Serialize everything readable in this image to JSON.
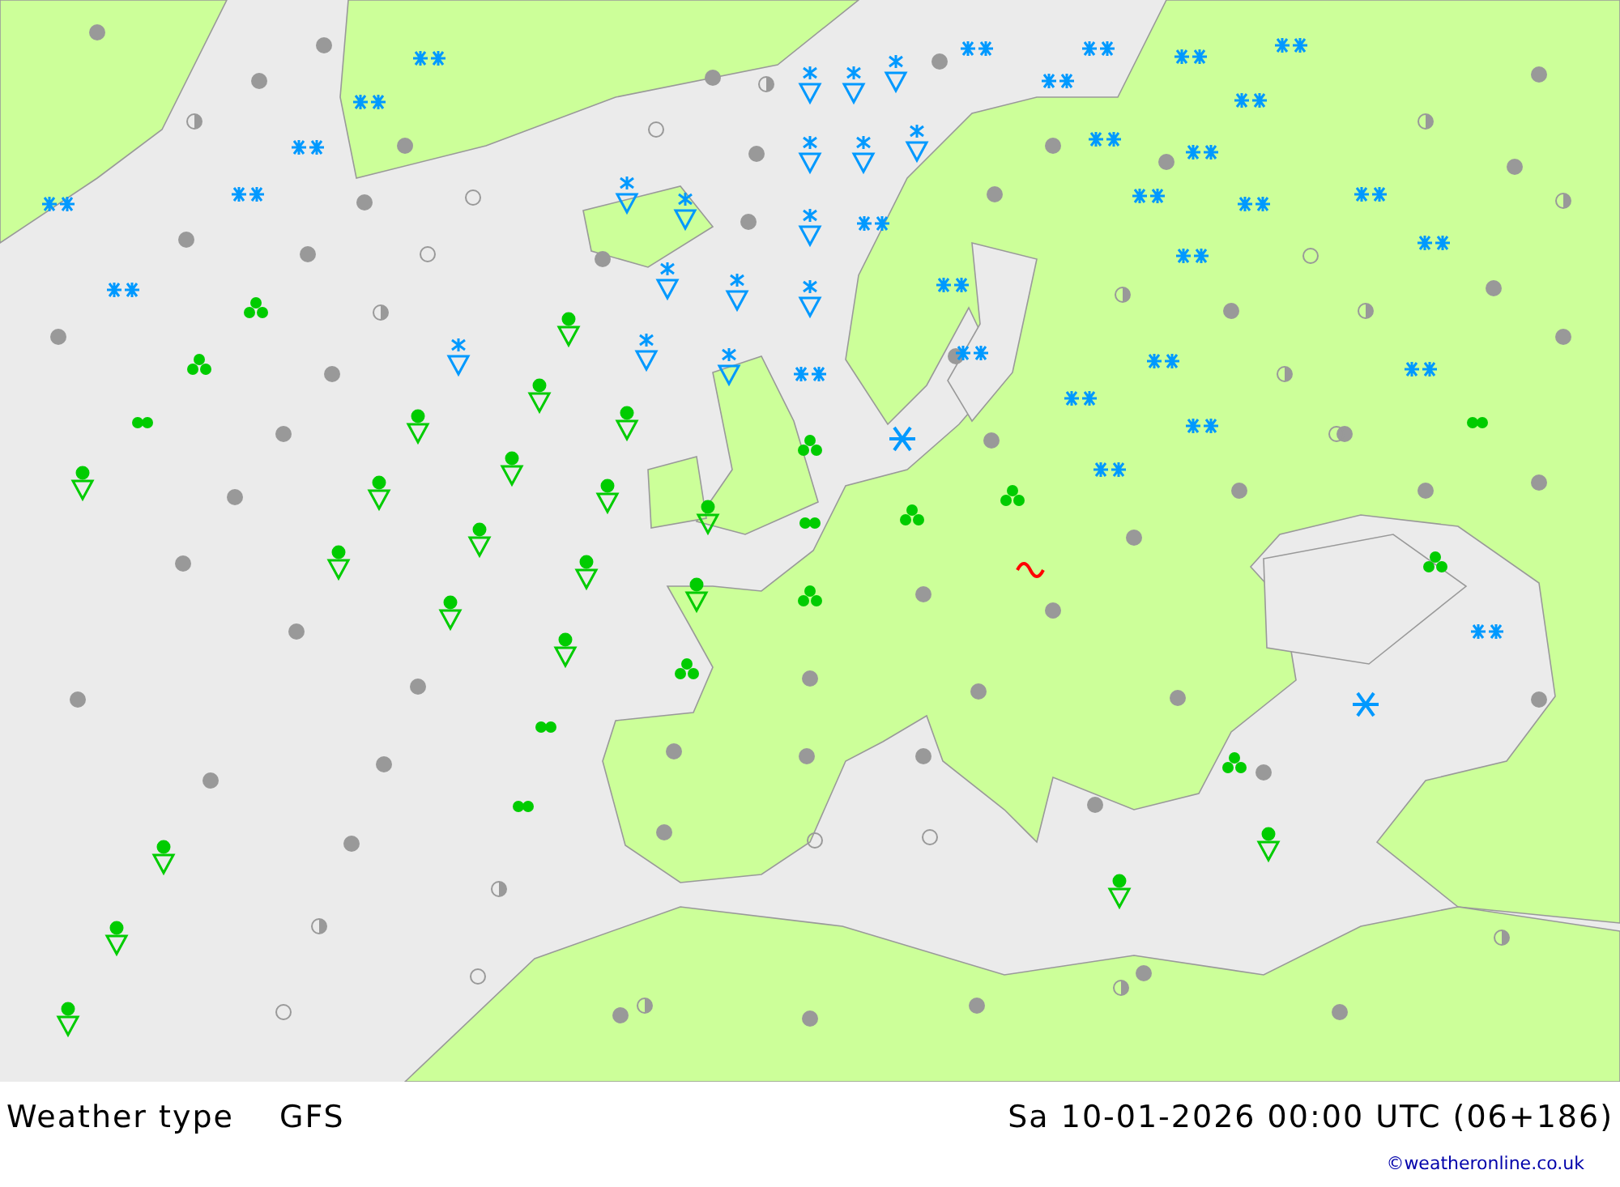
{
  "map": {
    "title": "Weather type",
    "model": "GFS",
    "valid_time": "Sa 10-01-2026 00:00 UTC (06+186)",
    "credit": "©weatheronline.co.uk"
  }
}
